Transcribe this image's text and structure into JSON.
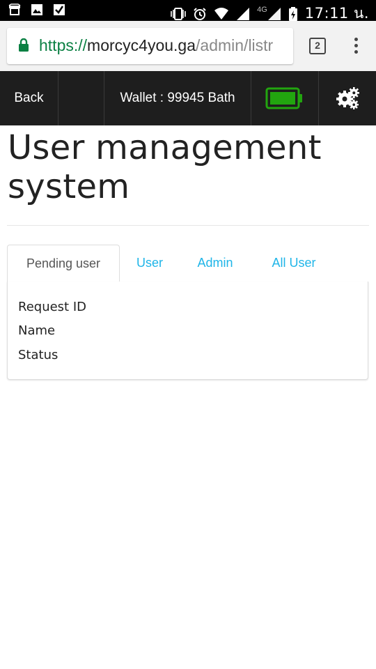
{
  "status_bar": {
    "network_label": "4G",
    "time": "17:11 น.",
    "icons": [
      "shop-icon",
      "image-icon",
      "check-icon",
      "vibrate-icon",
      "alarm-icon",
      "wifi-icon",
      "signal-icon",
      "signal-icon",
      "battery-charging-icon"
    ]
  },
  "browser": {
    "url_scheme": "https",
    "url_separator": "://",
    "url_host": "morcyc4you.ga",
    "url_path": "/admin/listr",
    "tab_count": "2",
    "secure_color": "#0b8043"
  },
  "navbar": {
    "back_label": "Back",
    "wallet_label": "Wallet : 99945 Bath",
    "battery_color": "#22a50f",
    "background": "#1e1e1e"
  },
  "page": {
    "title": "User management system"
  },
  "tabs": [
    {
      "label": "Pending user",
      "active": true
    },
    {
      "label": "User",
      "active": false
    },
    {
      "label": "Admin",
      "active": false
    },
    {
      "label": "All User",
      "active": false
    }
  ],
  "panel": {
    "fields": [
      "Request ID",
      "Name",
      "Status"
    ]
  },
  "colors": {
    "tab_link": "#1fb5e8",
    "text": "#222222"
  }
}
